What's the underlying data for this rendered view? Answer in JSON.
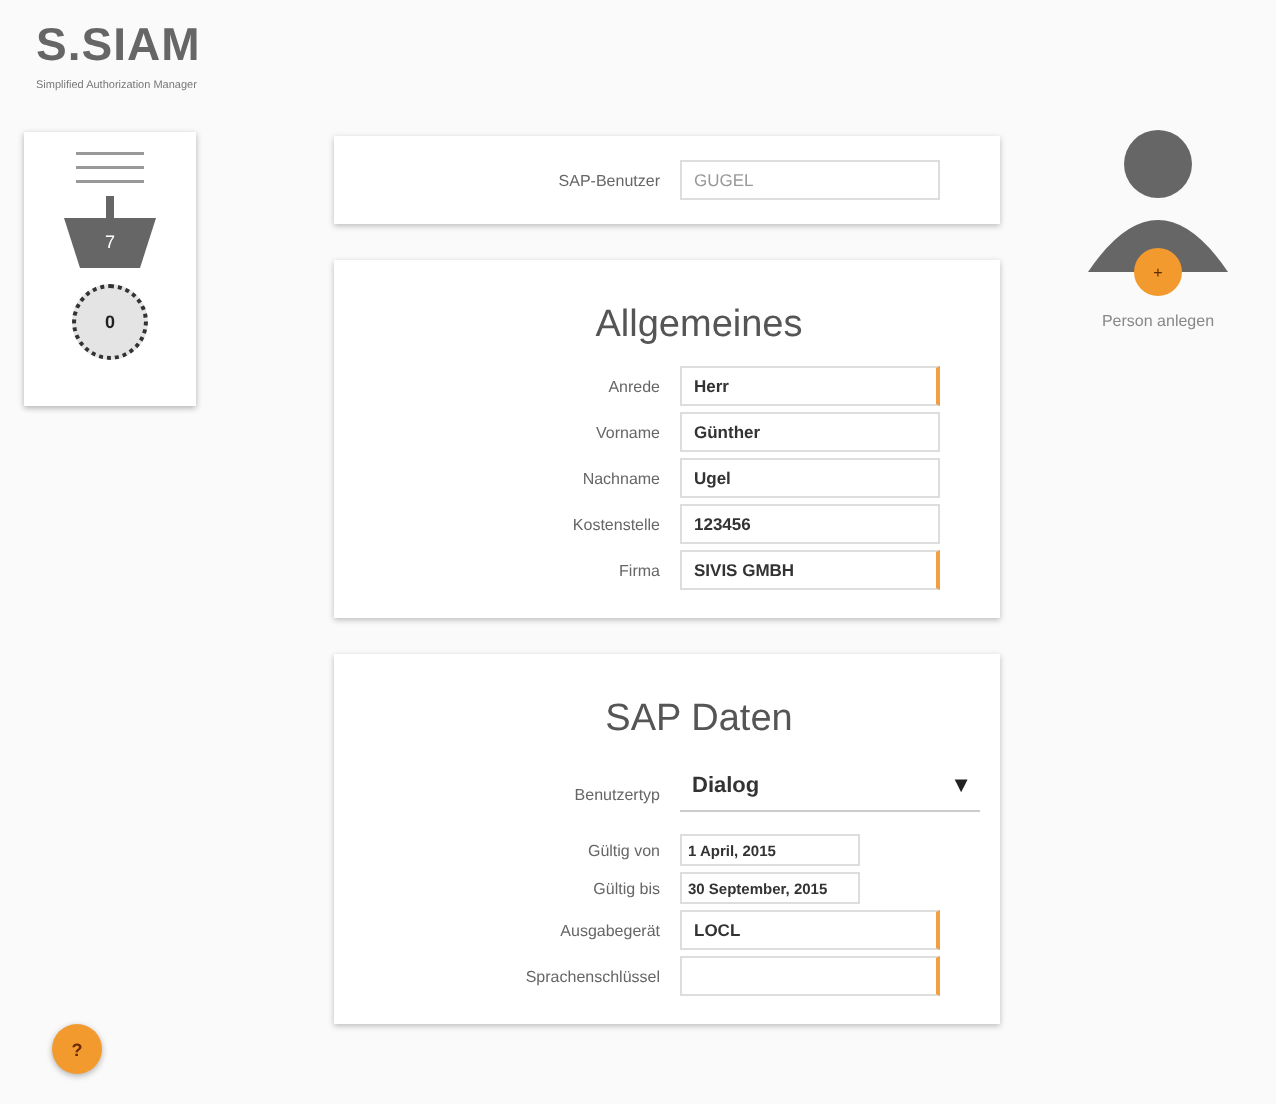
{
  "logo": {
    "name": "S.SIAM",
    "tagline": "Simplified Authorization Manager"
  },
  "sidebar": {
    "basket_count": "7",
    "pending_count": "0"
  },
  "sections": [
    {
      "fields": [
        {
          "kind": "text",
          "label": "SAP-Benutzer",
          "placeholder": "GUGEL",
          "required": false
        }
      ]
    },
    {
      "title": "Allgemeines",
      "fields": [
        {
          "kind": "text",
          "label": "Anrede",
          "value": "Herr",
          "required": true
        },
        {
          "kind": "text",
          "label": "Vorname",
          "value": "Günther",
          "required": false
        },
        {
          "kind": "text",
          "label": "Nachname",
          "value": "Ugel",
          "required": false
        },
        {
          "kind": "text",
          "label": "Kostenstelle",
          "value": "123456",
          "required": false
        },
        {
          "kind": "text",
          "label": "Firma",
          "value": "SIVIS GMBH",
          "required": true
        }
      ]
    },
    {
      "title": "SAP Daten",
      "fields": [
        {
          "kind": "select",
          "label": "Benutzertyp",
          "value": "Dialog",
          "caret": "▼"
        },
        {
          "kind": "date",
          "label": "Gültig von",
          "value": "1 April, 2015",
          "required": false
        },
        {
          "kind": "date",
          "label": "Gültig bis",
          "value": "30 September, 2015",
          "required": false
        },
        {
          "kind": "text",
          "label": "Ausgabegerät",
          "value": "LOCL",
          "required": true
        },
        {
          "kind": "text",
          "label": "Sprachenschlüssel",
          "required": true
        }
      ]
    }
  ],
  "person_action": {
    "label": "Person anlegen",
    "button": "+"
  },
  "help_button": "?"
}
